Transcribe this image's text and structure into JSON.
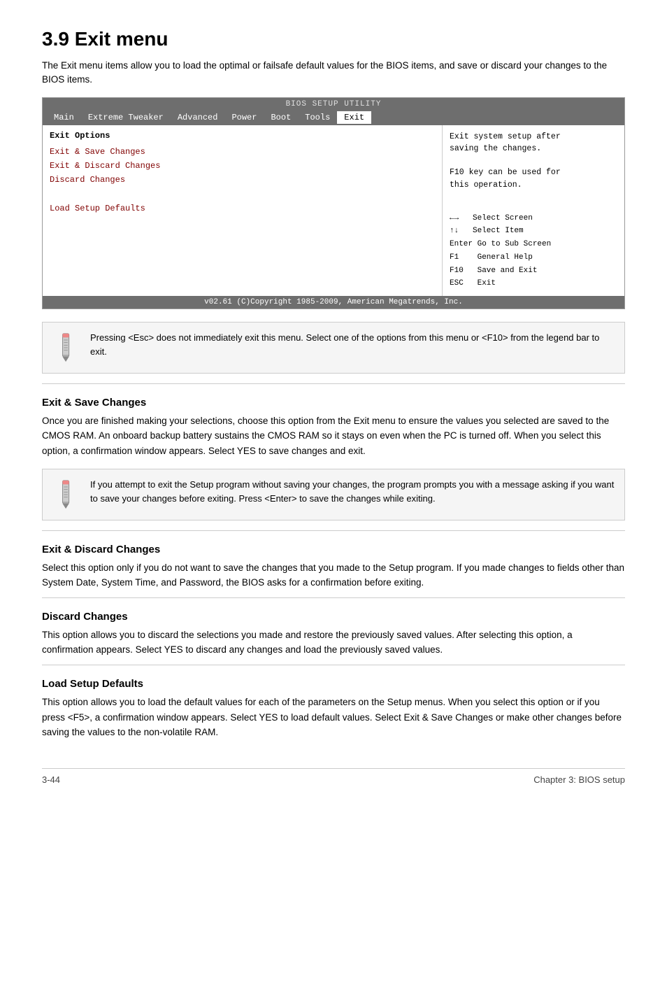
{
  "page": {
    "title": "3.9   Exit menu",
    "intro": "The Exit menu items allow you to load the optimal or failsafe default values for the BIOS items, and save or discard your changes to the BIOS items."
  },
  "bios": {
    "header_title": "BIOS SETUP UTILITY",
    "nav_items": [
      "Main",
      "Extreme Tweaker",
      "Advanced",
      "Power",
      "Boot",
      "Tools",
      "Exit"
    ],
    "active_nav": "Exit",
    "section_title": "Exit Options",
    "menu_items": [
      "Exit & Save Changes",
      "Exit & Discard Changes",
      "Discard Changes",
      "",
      "Load Setup Defaults"
    ],
    "help_lines": [
      "Exit system setup after",
      "saving the changes.",
      "",
      "F10 key can be used for",
      "this operation."
    ],
    "legend": [
      "←→   Select Screen",
      "↑↓   Select Item",
      "Enter Go to Sub Screen",
      "F1    General Help",
      "F10   Save and Exit",
      "ESC   Exit"
    ],
    "footer": "v02.61  (C)Copyright 1985-2009, American Megatrends, Inc."
  },
  "notes": {
    "note1": "Pressing <Esc> does not immediately exit this menu. Select one of the options from this menu or <F10> from the legend bar to exit.",
    "note2": " If you attempt to exit the Setup program without saving your changes, the program prompts you with a message asking if you want to save your changes before exiting. Press <Enter>  to save the changes while exiting."
  },
  "sections": [
    {
      "id": "exit-save",
      "heading": "Exit & Save Changes",
      "text": "Once you are finished making your selections, choose this option from the Exit menu to ensure the values you selected are saved to the CMOS RAM. An onboard backup battery sustains the CMOS RAM so it stays on even when the PC is turned off. When you select this option, a confirmation window appears. Select YES to save changes and exit."
    },
    {
      "id": "exit-discard",
      "heading": "Exit & Discard Changes",
      "text": "Select this option only if you do not want to save the changes that you  made to the Setup program. If you made changes to fields other than System Date, System Time, and Password, the BIOS asks for a confirmation before exiting."
    },
    {
      "id": "discard-changes",
      "heading": "Discard Changes",
      "text": "This option allows you to discard the selections you made and restore the previously saved values. After selecting this option, a confirmation appears. Select YES to discard any changes and load the previously saved values."
    },
    {
      "id": "load-defaults",
      "heading": "Load Setup Defaults",
      "text": "This option allows you to load the default values for each of the parameters on the Setup menus. When you select this option or if you press <F5>, a confirmation window appears. Select YES to load default values. Select Exit & Save Changes or make other changes before saving the values to the non-volatile RAM."
    }
  ],
  "footer": {
    "left": "3-44",
    "right": "Chapter 3: BIOS setup"
  }
}
